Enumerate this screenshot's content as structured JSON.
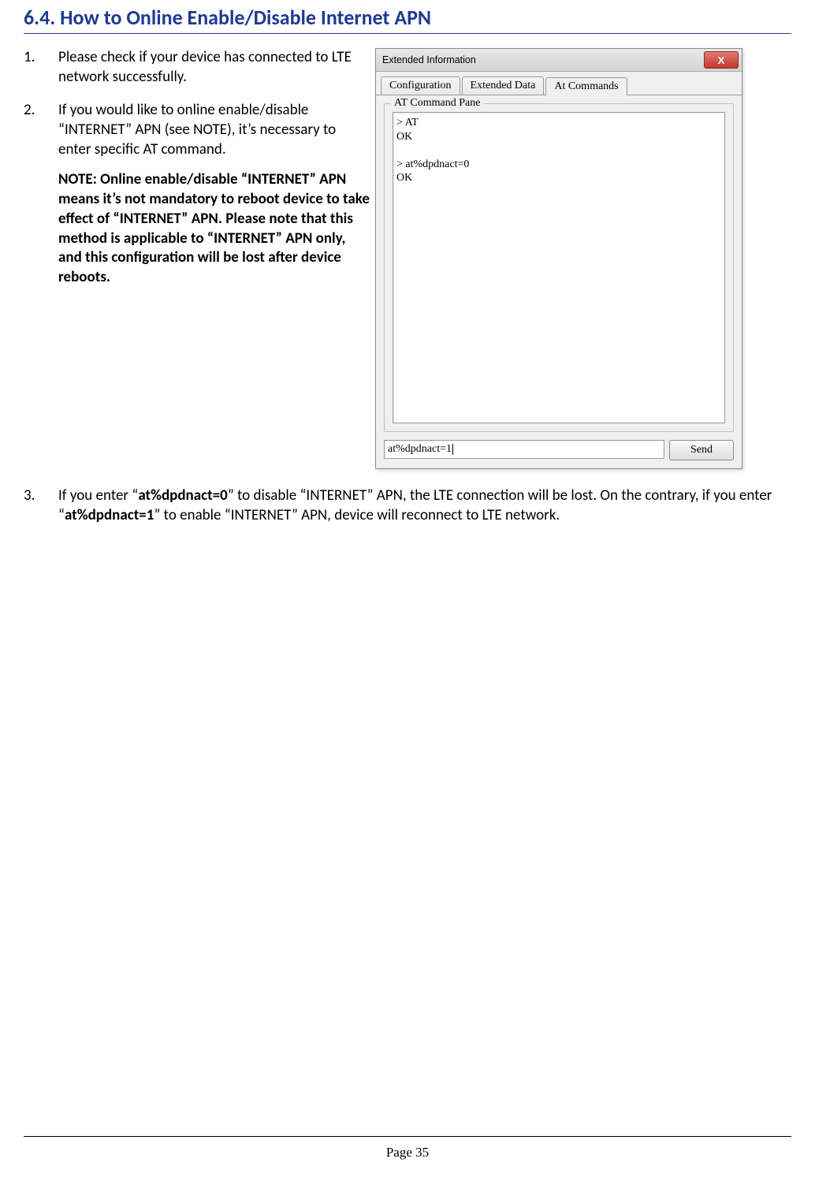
{
  "heading": "6.4. How to Online Enable/Disable Internet APN",
  "steps": {
    "s1": "Please check if your device has connected to LTE network successfully.",
    "s2": "If you would like to online enable/disable “INTERNET” APN (see NOTE), it’s necessary to enter specific AT command.",
    "note": "NOTE: Online enable/disable “INTERNET” APN means it’s not mandatory to reboot device to take effect of “INTERNET” APN. Please note that this method is applicable to “INTERNET” APN only, and this configuration will be lost after device reboots.",
    "s3_a": "If you enter “",
    "s3_cmd0": "at%dpdnact=0",
    "s3_b": "” to disable “INTERNET” APN, the LTE connection will be lost. On the contrary, if you enter “",
    "s3_cmd1": "at%dpdnact=1",
    "s3_c": "” to enable “INTERNET” APN, device will reconnect to LTE network."
  },
  "dialog": {
    "title": "Extended Information",
    "close": "X",
    "tabs": {
      "config": "Configuration",
      "extdata": "Extended Data",
      "atcmds": "At Commands"
    },
    "group_title": "AT Command Pane",
    "console_text": "> AT\nOK\n\n> at%dpdnact=0\nOK",
    "input_value": "at%dpdnact=1",
    "send_label": "Send"
  },
  "page_number": "Page 35"
}
